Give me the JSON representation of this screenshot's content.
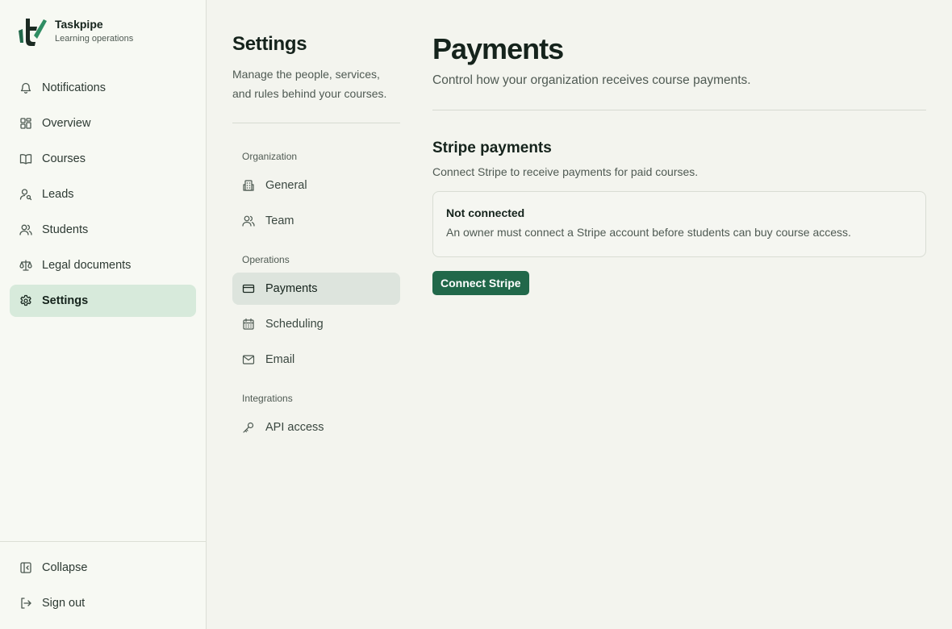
{
  "brand": {
    "name": "Taskpipe",
    "subtitle": "Learning operations"
  },
  "sidebar": {
    "items": [
      {
        "label": "Notifications",
        "icon": "bell-icon"
      },
      {
        "label": "Overview",
        "icon": "dashboard-icon"
      },
      {
        "label": "Courses",
        "icon": "book-icon"
      },
      {
        "label": "Leads",
        "icon": "user-search-icon"
      },
      {
        "label": "Students",
        "icon": "users-icon"
      },
      {
        "label": "Legal documents",
        "icon": "scale-icon"
      },
      {
        "label": "Settings",
        "icon": "gear-icon",
        "active": true
      }
    ],
    "footer": [
      {
        "label": "Collapse",
        "icon": "collapse-icon"
      },
      {
        "label": "Sign out",
        "icon": "sign-out-icon"
      }
    ]
  },
  "settings": {
    "title": "Settings",
    "description": "Manage the people, services, and rules behind your courses.",
    "groups": [
      {
        "label": "Organization",
        "items": [
          {
            "label": "General",
            "icon": "building-icon"
          },
          {
            "label": "Team",
            "icon": "team-icon"
          }
        ]
      },
      {
        "label": "Operations",
        "items": [
          {
            "label": "Payments",
            "icon": "credit-card-icon",
            "active": true
          },
          {
            "label": "Scheduling",
            "icon": "calendar-icon"
          },
          {
            "label": "Email",
            "icon": "mail-icon"
          }
        ]
      },
      {
        "label": "Integrations",
        "items": [
          {
            "label": "API access",
            "icon": "key-icon"
          }
        ]
      }
    ]
  },
  "main": {
    "title": "Payments",
    "description": "Control how your organization receives course payments.",
    "section": {
      "title": "Stripe payments",
      "description": "Connect Stripe to receive payments for paid courses."
    },
    "status": {
      "title": "Not connected",
      "text": "An owner must connect a Stripe account before students can buy course access."
    },
    "connect_button": "Connect Stripe"
  },
  "colors": {
    "accent": "#21684a",
    "active_nav_bg": "#d7eadb",
    "active_subnav_bg": "#dde4dd",
    "background": "#f3f4ee"
  }
}
